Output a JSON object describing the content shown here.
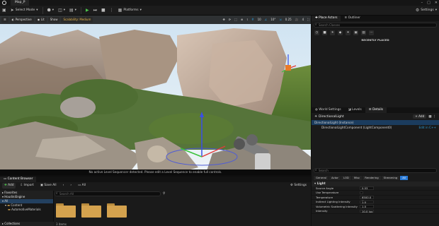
{
  "titlebar": {
    "tab": "Map_P"
  },
  "toolbar": {
    "select_mode": "Select Mode",
    "platforms": "Platforms",
    "settings": "Settings"
  },
  "viewport": {
    "perspective": "Perspective",
    "lit": "Lit",
    "show": "Show",
    "scalability": "Scalability: Medium",
    "grid_value": "10",
    "rot_value": "10°",
    "scale_value": "0.25",
    "cam_speed": "4",
    "message": "No active Level Sequencer detected. Please edit a Level Sequence to enable full controls."
  },
  "place_actors": {
    "tab": "Place Actors",
    "outliner_tab": "Outliner",
    "search_placeholder": "Search Classes",
    "recently_placed": "RECENTLY PLACED"
  },
  "details": {
    "tabs": [
      "World Settings",
      "Levels",
      "Details"
    ],
    "actor_name": "DirectionalLight",
    "add_label": "+ Add",
    "rows": [
      {
        "label": "DirectionalLight (Instance)",
        "selected": true
      },
      {
        "label": "DirectionalLightComponent (LightComponent0)",
        "selected": false,
        "right": "Edit in C++"
      }
    ],
    "search_placeholder": "Search",
    "categories": [
      "General",
      "Actor",
      "LOD",
      "Misc",
      "Rendering",
      "Streaming",
      "All"
    ],
    "section": "Light",
    "properties": [
      {
        "key": "Source Angle",
        "value": "0.53"
      },
      {
        "key": "Use Temperature",
        "value": ""
      },
      {
        "key": "Temperature",
        "value": "6500.0 K"
      },
      {
        "key": "Indirect Lighting Intensity",
        "value": "1.0"
      },
      {
        "key": "Volumetric Scattering Intensity",
        "value": "1.0"
      },
      {
        "key": "Intensity",
        "value": "10.0 lux"
      }
    ]
  },
  "content_browser": {
    "tab": "Content Browser",
    "add": "Add",
    "import": "Import",
    "save_all": "Save All",
    "path": "All",
    "settings": "Settings",
    "favorites": "Favorites",
    "project": "HoudiniEngine",
    "tree": [
      "All",
      "Content",
      "AutomotiveMaterials"
    ],
    "collections": "Collections",
    "search_placeholder": "Search All",
    "items_count": "3 items"
  }
}
